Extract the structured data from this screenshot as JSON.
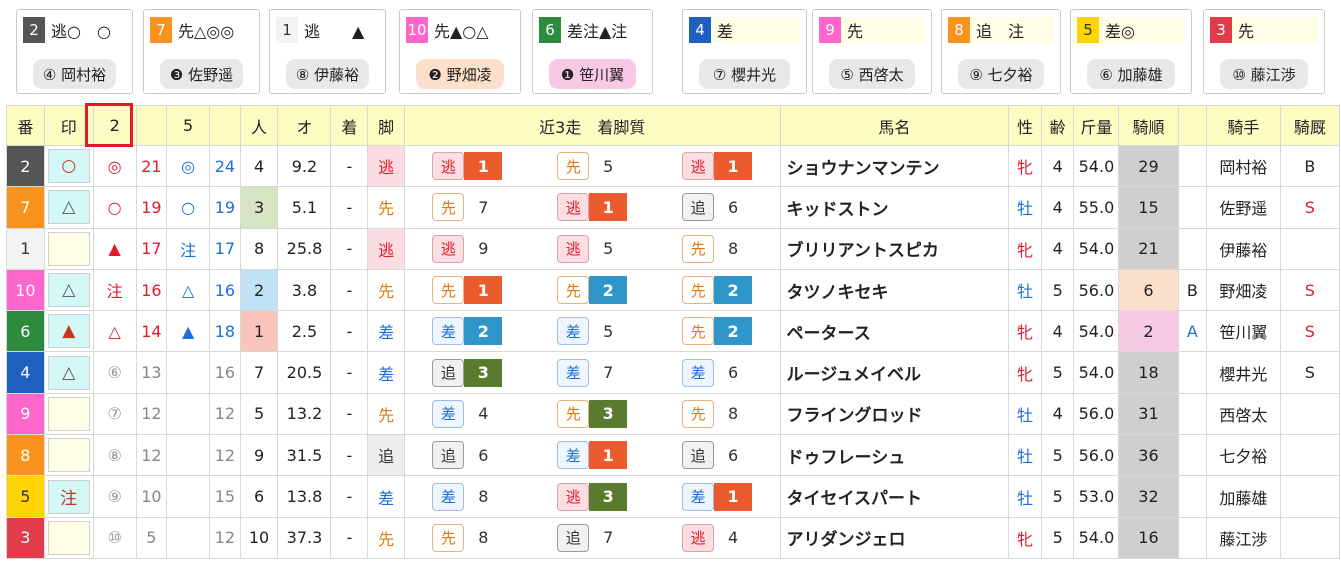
{
  "cards": [
    {
      "num": "2",
      "num_color": "#555555",
      "num_text": "#ffffff",
      "marks": "逃○　○",
      "marks_bg": "#ffffff",
      "jockey": "④ 岡村裕",
      "pill": "gray"
    },
    {
      "num": "7",
      "num_color": "#f7931e",
      "num_text": "#ffffff",
      "marks": "先△◎◎",
      "marks_bg": "#ffffff",
      "jockey": "❸ 佐野遥",
      "pill": "gray"
    },
    {
      "num": "1",
      "num_color": "#f3f3f3",
      "num_text": "#333333",
      "marks": "逃　　▲",
      "marks_bg": "#ffffff",
      "jockey": "⑧ 伊藤裕",
      "pill": "gray"
    },
    {
      "num": "10",
      "num_color": "#ff66cc",
      "num_text": "#ffffff",
      "marks": "先▲○△",
      "marks_bg": "#ffffff",
      "jockey": "❷ 野畑凌",
      "pill": "peach"
    },
    {
      "num": "6",
      "num_color": "#2e8b3e",
      "num_text": "#ffffff",
      "marks": "差注▲注",
      "marks_bg": "#ffffff",
      "jockey": "❶ 笹川翼",
      "pill": "pink"
    },
    {
      "num": "4",
      "num_color": "#1f5fbf",
      "num_text": "#ffffff",
      "marks": "差",
      "marks_bg": "#fefde6",
      "jockey": "⑦ 櫻井光",
      "pill": "gray"
    },
    {
      "num": "9",
      "num_color": "#ff66cc",
      "num_text": "#ffffff",
      "marks": "先",
      "marks_bg": "#fefde6",
      "jockey": "⑤ 西啓太",
      "pill": "gray"
    },
    {
      "num": "8",
      "num_color": "#f7931e",
      "num_text": "#ffffff",
      "marks": "追　注",
      "marks_bg": "#fefde6",
      "jockey": "⑨ 七夕裕",
      "pill": "gray"
    },
    {
      "num": "5",
      "num_color": "#ffd400",
      "num_text": "#333333",
      "marks": "差◎",
      "marks_bg": "#fefde6",
      "jockey": "⑥ 加藤雄",
      "pill": "gray"
    },
    {
      "num": "3",
      "num_color": "#e23c4b",
      "num_text": "#ffffff",
      "marks": "先",
      "marks_bg": "#fefde6",
      "jockey": "⑩ 藤江渉",
      "pill": "gray"
    }
  ],
  "headers": {
    "ban": "番",
    "shirushi": "印",
    "c2": "2",
    "c2b": "",
    "c5": "5",
    "c5b": "",
    "ninki": "人",
    "odds": "オ",
    "chaku": "着",
    "kyaku": "脚",
    "recent": "近3走　着脚質",
    "name": "馬名",
    "sex": "性",
    "age": "齢",
    "weight": "斤量",
    "order": "騎順",
    "blank": "",
    "jockey": "騎手",
    "stable": "騎厩"
  },
  "rows": [
    {
      "ban": "2",
      "ban_color": "#555555",
      "mark": "○",
      "mark_bg": "#d4f7f7",
      "mark_color": "#c23a1e",
      "m2": "◎",
      "m2c": "red",
      "m2n": "21",
      "m2nc": "red",
      "m5": "◎",
      "m5c": "blue",
      "m5n": "24",
      "m5nc": "blue",
      "ninki": "4",
      "ninki_bg": "",
      "odds": "9.2",
      "chaku": "-",
      "kyaku": "逃",
      "kyaku_cls": "esc",
      "r": [
        {
          "s": "逃",
          "sc": "esc",
          "f": "1",
          "fc": "c1"
        },
        {
          "s": "先",
          "sc": "sen",
          "f": "5",
          "fc": "plain"
        },
        {
          "s": "逃",
          "sc": "esc",
          "f": "1",
          "fc": "c1"
        }
      ],
      "name": "ショウナンマンテン",
      "sex": "牝",
      "sexc": "red",
      "age": "4",
      "weight": "54.0",
      "order": "29",
      "order_cls": "",
      "blank": "",
      "jockey": "岡村裕",
      "stable": "B",
      "stable_c": ""
    },
    {
      "ban": "7",
      "ban_color": "#f7931e",
      "mark": "△",
      "mark_bg": "#d4f7f7",
      "mark_color": "#555",
      "m2": "○",
      "m2c": "red",
      "m2n": "19",
      "m2nc": "red",
      "m5": "○",
      "m5c": "blue",
      "m5n": "19",
      "m5nc": "blue",
      "ninki": "3",
      "ninki_bg": "#d6e4c4",
      "odds": "5.1",
      "chaku": "-",
      "kyaku": "先",
      "kyaku_cls": "sen",
      "r": [
        {
          "s": "先",
          "sc": "sen",
          "f": "7",
          "fc": "plain"
        },
        {
          "s": "逃",
          "sc": "esc",
          "f": "1",
          "fc": "c1"
        },
        {
          "s": "追",
          "sc": "oi",
          "f": "6",
          "fc": "plain"
        }
      ],
      "name": "キッドストン",
      "sex": "牡",
      "sexc": "blue",
      "age": "4",
      "weight": "55.0",
      "order": "15",
      "order_cls": "",
      "blank": "",
      "jockey": "佐野遥",
      "stable": "S",
      "stable_c": "red"
    },
    {
      "ban": "1",
      "ban_color": "#f3f3f3",
      "ban_text": "#333",
      "mark": "",
      "mark_bg": "#fefde6",
      "mark_color": "#555",
      "m2": "▲",
      "m2c": "red",
      "m2n": "17",
      "m2nc": "red",
      "m5": "注",
      "m5c": "blue",
      "m5n": "17",
      "m5nc": "blue",
      "ninki": "8",
      "ninki_bg": "",
      "odds": "25.8",
      "chaku": "-",
      "kyaku": "逃",
      "kyaku_cls": "esc",
      "r": [
        {
          "s": "逃",
          "sc": "esc",
          "f": "9",
          "fc": "plain"
        },
        {
          "s": "逃",
          "sc": "esc",
          "f": "5",
          "fc": "plain"
        },
        {
          "s": "先",
          "sc": "sen",
          "f": "8",
          "fc": "plain"
        }
      ],
      "name": "ブリリアントスピカ",
      "sex": "牝",
      "sexc": "red",
      "age": "4",
      "weight": "54.0",
      "order": "21",
      "order_cls": "",
      "blank": "",
      "jockey": "伊藤裕",
      "stable": "",
      "stable_c": ""
    },
    {
      "ban": "10",
      "ban_color": "#ff66cc",
      "mark": "△",
      "mark_bg": "#d4f7f7",
      "mark_color": "#555",
      "m2": "注",
      "m2c": "red",
      "m2n": "16",
      "m2nc": "red",
      "m5": "△",
      "m5c": "blue",
      "m5n": "16",
      "m5nc": "blue",
      "ninki": "2",
      "ninki_bg": "#bfe3f5",
      "odds": "3.8",
      "chaku": "-",
      "kyaku": "先",
      "kyaku_cls": "sen",
      "r": [
        {
          "s": "先",
          "sc": "sen",
          "f": "1",
          "fc": "c1"
        },
        {
          "s": "先",
          "sc": "sen",
          "f": "2",
          "fc": "c2"
        },
        {
          "s": "先",
          "sc": "sen",
          "f": "2",
          "fc": "c2"
        }
      ],
      "name": "タツノキセキ",
      "sex": "牡",
      "sexc": "blue",
      "age": "5",
      "weight": "56.0",
      "order": "6",
      "order_cls": "peach",
      "blank": "B",
      "jockey": "野畑凌",
      "stable": "S",
      "stable_c": "red"
    },
    {
      "ban": "6",
      "ban_color": "#2e8b3e",
      "mark": "▲",
      "mark_bg": "#d4f7f7",
      "mark_color": "#c23a1e",
      "m2": "△",
      "m2c": "red",
      "m2n": "14",
      "m2nc": "red",
      "m5": "▲",
      "m5c": "blue",
      "m5n": "18",
      "m5nc": "blue",
      "ninki": "1",
      "ninki_bg": "#f9c5bb",
      "odds": "2.5",
      "chaku": "-",
      "kyaku": "差",
      "kyaku_cls": "sashi",
      "r": [
        {
          "s": "差",
          "sc": "sashi",
          "f": "2",
          "fc": "c2"
        },
        {
          "s": "差",
          "sc": "sashi",
          "f": "5",
          "fc": "plain"
        },
        {
          "s": "先",
          "sc": "sen",
          "f": "2",
          "fc": "c2"
        }
      ],
      "name": "ペータース",
      "sex": "牝",
      "sexc": "red",
      "age": "4",
      "weight": "54.0",
      "order": "2",
      "order_cls": "pink",
      "blank": "A",
      "jockey": "笹川翼",
      "stable": "S",
      "stable_c": "red"
    },
    {
      "ban": "4",
      "ban_color": "#1f5fbf",
      "mark": "△",
      "mark_bg": "#d4f7f7",
      "mark_color": "#555",
      "m2": "⑥",
      "m2c": "gray",
      "m2n": "13",
      "m2nc": "dgray",
      "m5": "",
      "m5c": "",
      "m5n": "16",
      "m5nc": "dgray",
      "ninki": "7",
      "ninki_bg": "",
      "odds": "20.5",
      "chaku": "-",
      "kyaku": "差",
      "kyaku_cls": "sashi",
      "r": [
        {
          "s": "追",
          "sc": "oi",
          "f": "3",
          "fc": "c3"
        },
        {
          "s": "差",
          "sc": "sashi",
          "f": "7",
          "fc": "plain"
        },
        {
          "s": "差",
          "sc": "sashi",
          "f": "6",
          "fc": "plain"
        }
      ],
      "name": "ルージュメイベル",
      "sex": "牝",
      "sexc": "red",
      "age": "5",
      "weight": "54.0",
      "order": "18",
      "order_cls": "",
      "blank": "",
      "jockey": "櫻井光",
      "stable": "S",
      "stable_c": ""
    },
    {
      "ban": "9",
      "ban_color": "#ff66cc",
      "mark": "",
      "mark_bg": "#fefde6",
      "mark_color": "#555",
      "m2": "⑦",
      "m2c": "gray",
      "m2n": "12",
      "m2nc": "dgray",
      "m5": "",
      "m5c": "",
      "m5n": "12",
      "m5nc": "dgray",
      "ninki": "5",
      "ninki_bg": "",
      "odds": "13.2",
      "chaku": "-",
      "kyaku": "先",
      "kyaku_cls": "sen",
      "r": [
        {
          "s": "差",
          "sc": "sashi",
          "f": "4",
          "fc": "plain"
        },
        {
          "s": "先",
          "sc": "sen",
          "f": "3",
          "fc": "c3"
        },
        {
          "s": "先",
          "sc": "sen",
          "f": "8",
          "fc": "plain"
        }
      ],
      "name": "フライングロッド",
      "sex": "牡",
      "sexc": "blue",
      "age": "4",
      "weight": "56.0",
      "order": "31",
      "order_cls": "",
      "blank": "",
      "jockey": "西啓太",
      "stable": "",
      "stable_c": ""
    },
    {
      "ban": "8",
      "ban_color": "#f7931e",
      "mark": "",
      "mark_bg": "#fefde6",
      "mark_color": "#555",
      "m2": "⑧",
      "m2c": "gray",
      "m2n": "12",
      "m2nc": "dgray",
      "m5": "",
      "m5c": "",
      "m5n": "12",
      "m5nc": "dgray",
      "ninki": "9",
      "ninki_bg": "",
      "odds": "31.5",
      "chaku": "-",
      "kyaku": "追",
      "kyaku_cls": "oi",
      "r": [
        {
          "s": "追",
          "sc": "oi",
          "f": "6",
          "fc": "plain"
        },
        {
          "s": "差",
          "sc": "sashi",
          "f": "1",
          "fc": "c1"
        },
        {
          "s": "追",
          "sc": "oi",
          "f": "6",
          "fc": "plain"
        }
      ],
      "name": "ドゥフレーシュ",
      "sex": "牡",
      "sexc": "blue",
      "age": "5",
      "weight": "56.0",
      "order": "36",
      "order_cls": "",
      "blank": "",
      "jockey": "七夕裕",
      "stable": "",
      "stable_c": ""
    },
    {
      "ban": "5",
      "ban_color": "#ffd400",
      "ban_text": "#333",
      "mark": "注",
      "mark_bg": "#d4f7f7",
      "mark_color": "#c23a1e",
      "m2": "⑨",
      "m2c": "gray",
      "m2n": "10",
      "m2nc": "dgray",
      "m5": "",
      "m5c": "",
      "m5n": "15",
      "m5nc": "dgray",
      "ninki": "6",
      "ninki_bg": "",
      "odds": "13.8",
      "chaku": "-",
      "kyaku": "差",
      "kyaku_cls": "sashi",
      "r": [
        {
          "s": "差",
          "sc": "sashi",
          "f": "8",
          "fc": "plain"
        },
        {
          "s": "逃",
          "sc": "esc",
          "f": "3",
          "fc": "c3"
        },
        {
          "s": "差",
          "sc": "sashi",
          "f": "1",
          "fc": "c1"
        }
      ],
      "name": "タイセイスパート",
      "sex": "牡",
      "sexc": "blue",
      "age": "5",
      "weight": "53.0",
      "order": "32",
      "order_cls": "",
      "blank": "",
      "jockey": "加藤雄",
      "stable": "",
      "stable_c": ""
    },
    {
      "ban": "3",
      "ban_color": "#e23c4b",
      "mark": "",
      "mark_bg": "#fefde6",
      "mark_color": "#555",
      "m2": "⑩",
      "m2c": "gray",
      "m2n": "5",
      "m2nc": "dgray",
      "m5": "",
      "m5c": "",
      "m5n": "12",
      "m5nc": "dgray",
      "ninki": "10",
      "ninki_bg": "",
      "odds": "37.3",
      "chaku": "-",
      "kyaku": "先",
      "kyaku_cls": "sen",
      "r": [
        {
          "s": "先",
          "sc": "sen",
          "f": "8",
          "fc": "plain"
        },
        {
          "s": "追",
          "sc": "oi",
          "f": "7",
          "fc": "plain"
        },
        {
          "s": "逃",
          "sc": "esc",
          "f": "4",
          "fc": "plain"
        }
      ],
      "name": "アリダンジェロ",
      "sex": "牝",
      "sexc": "red",
      "age": "5",
      "weight": "54.0",
      "order": "16",
      "order_cls": "",
      "blank": "",
      "jockey": "藤江渉",
      "stable": "",
      "stable_c": ""
    }
  ]
}
